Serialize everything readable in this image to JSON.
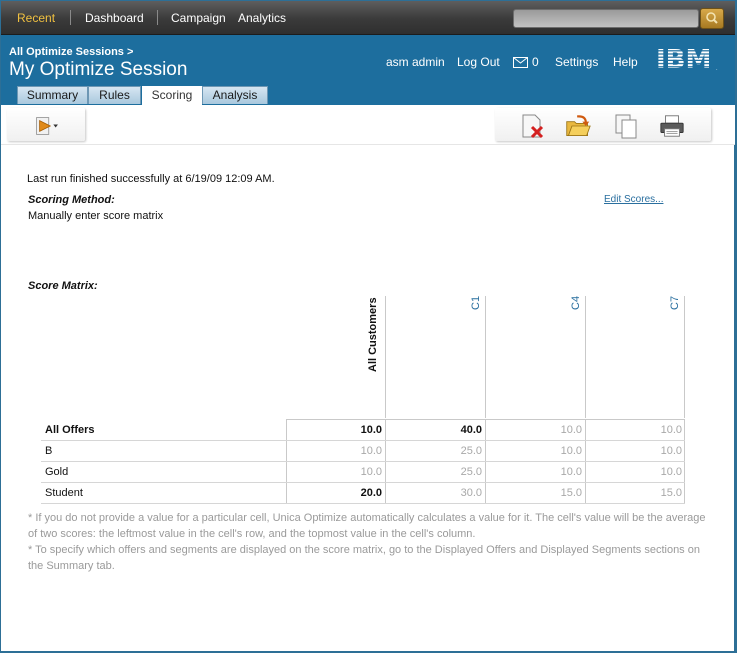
{
  "topnav": {
    "items": [
      {
        "label": "Recent",
        "active": true
      },
      {
        "label": "Dashboard",
        "active": false
      },
      {
        "label": "Campaign",
        "active": false
      },
      {
        "label": "Analytics",
        "active": false
      }
    ],
    "search_placeholder": ""
  },
  "header": {
    "breadcrumb": "All Optimize Sessions >",
    "title": "My Optimize Session",
    "user": "asm admin",
    "logout": "Log Out",
    "mail_count": "0",
    "settings": "Settings",
    "help": "Help",
    "logo": "IBM"
  },
  "tabs": [
    {
      "label": "Summary",
      "active": false
    },
    {
      "label": "Rules",
      "active": false
    },
    {
      "label": "Scoring",
      "active": true
    },
    {
      "label": "Analysis",
      "active": false
    }
  ],
  "toolbar": {
    "run_icon": "run-dropdown-icon",
    "delete_icon": "delete-document-icon",
    "open_icon": "open-folder-icon",
    "copy_icon": "copy-icon",
    "print_icon": "print-icon"
  },
  "content": {
    "run_status": "Last run finished successfully at 6/19/09 12:09 AM.",
    "scoring_method_label": "Scoring Method:",
    "scoring_method_value": "Manually enter score matrix",
    "edit_scores": "Edit Scores...",
    "score_matrix_label": "Score Matrix:",
    "columns": [
      "All Customers",
      "C1",
      "C4",
      "C7"
    ],
    "rows": [
      {
        "label": "All Offers",
        "label_bold": true,
        "values": [
          "10.0",
          "40.0",
          "10.0",
          "10.0"
        ],
        "bold": [
          true,
          true,
          false,
          false
        ]
      },
      {
        "label": "B",
        "label_bold": false,
        "values": [
          "10.0",
          "25.0",
          "10.0",
          "10.0"
        ],
        "bold": [
          false,
          false,
          false,
          false
        ]
      },
      {
        "label": "Gold",
        "label_bold": false,
        "values": [
          "10.0",
          "25.0",
          "10.0",
          "10.0"
        ],
        "bold": [
          false,
          false,
          false,
          false
        ]
      },
      {
        "label": "Student",
        "label_bold": false,
        "values": [
          "20.0",
          "30.0",
          "15.0",
          "15.0"
        ],
        "bold": [
          true,
          false,
          false,
          false
        ]
      }
    ],
    "footnote1": "* If you do not provide a value for a particular cell, Unica Optimize automatically calculates a value for it. The cell's value will be the average of two scores: the leftmost value in the cell's row, and the topmost value in the cell's column.",
    "footnote2": "* To specify which offers and segments are displayed on the score matrix, go to the Displayed Offers and Displayed Segments sections on the Summary tab."
  },
  "colors": {
    "header_blue": "#1d6e9e",
    "nav_active": "#f0c040",
    "link_blue": "#2a6f9f"
  }
}
